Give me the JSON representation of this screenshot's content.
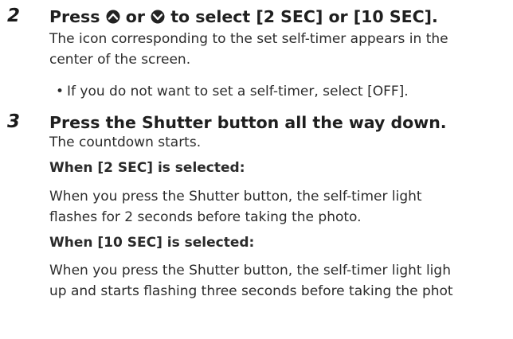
{
  "step2": {
    "number": "2",
    "title_prefix": "Press",
    "title_or": "or",
    "title_suffix": "to select [2 SEC] or [10 SEC].",
    "up_icon": "up-arrow-button-icon",
    "down_icon": "down-arrow-button-icon",
    "description_line1": "The icon corresponding to the set self-timer appears in the",
    "description_line2": "center of the screen.",
    "bullet_marker": "•",
    "bullet_text": "If you do not want to set a self-timer, select [OFF]."
  },
  "step3": {
    "number": "3",
    "title": "Press the Shutter button all the way down.",
    "description": "The countdown starts.",
    "section_2sec": {
      "heading": "When [2 SEC] is selected:",
      "line1": "When you press the Shutter button, the self-timer light",
      "line2": "flashes for 2 seconds before taking the photo."
    },
    "section_10sec": {
      "heading": "When [10 SEC] is selected:",
      "line1": "When you press the Shutter button, the self-timer light ligh",
      "line2": "up and starts flashing three seconds before taking the phot"
    }
  },
  "colors": {
    "text": "#2b2b2b",
    "heading": "#1f1f1f"
  }
}
